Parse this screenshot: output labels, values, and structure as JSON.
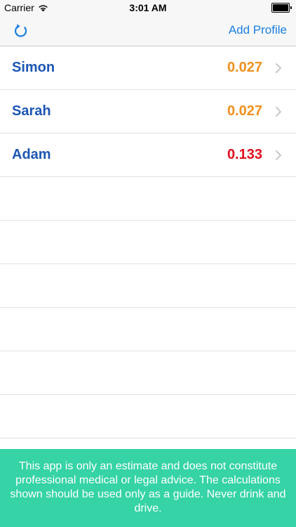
{
  "status_bar": {
    "carrier": "Carrier",
    "time": "3:01 AM",
    "battery_level": 1.0
  },
  "nav_bar": {
    "refresh_icon": "refresh-icon",
    "add_profile_label": "Add Profile",
    "accent_color": "#1a7fe0"
  },
  "profiles": [
    {
      "name": "Simon",
      "value": "0.027",
      "value_color": "#f0901e"
    },
    {
      "name": "Sarah",
      "value": "0.027",
      "value_color": "#f0901e"
    },
    {
      "name": "Adam",
      "value": "0.133",
      "value_color": "#e0101e"
    }
  ],
  "empty_rows": 6,
  "disclaimer": {
    "text": "This app is only an estimate and does not constitute professional medical or legal advice. The calculations shown should be used only as a guide. Never drink and drive.",
    "background": "#35d3a6"
  }
}
